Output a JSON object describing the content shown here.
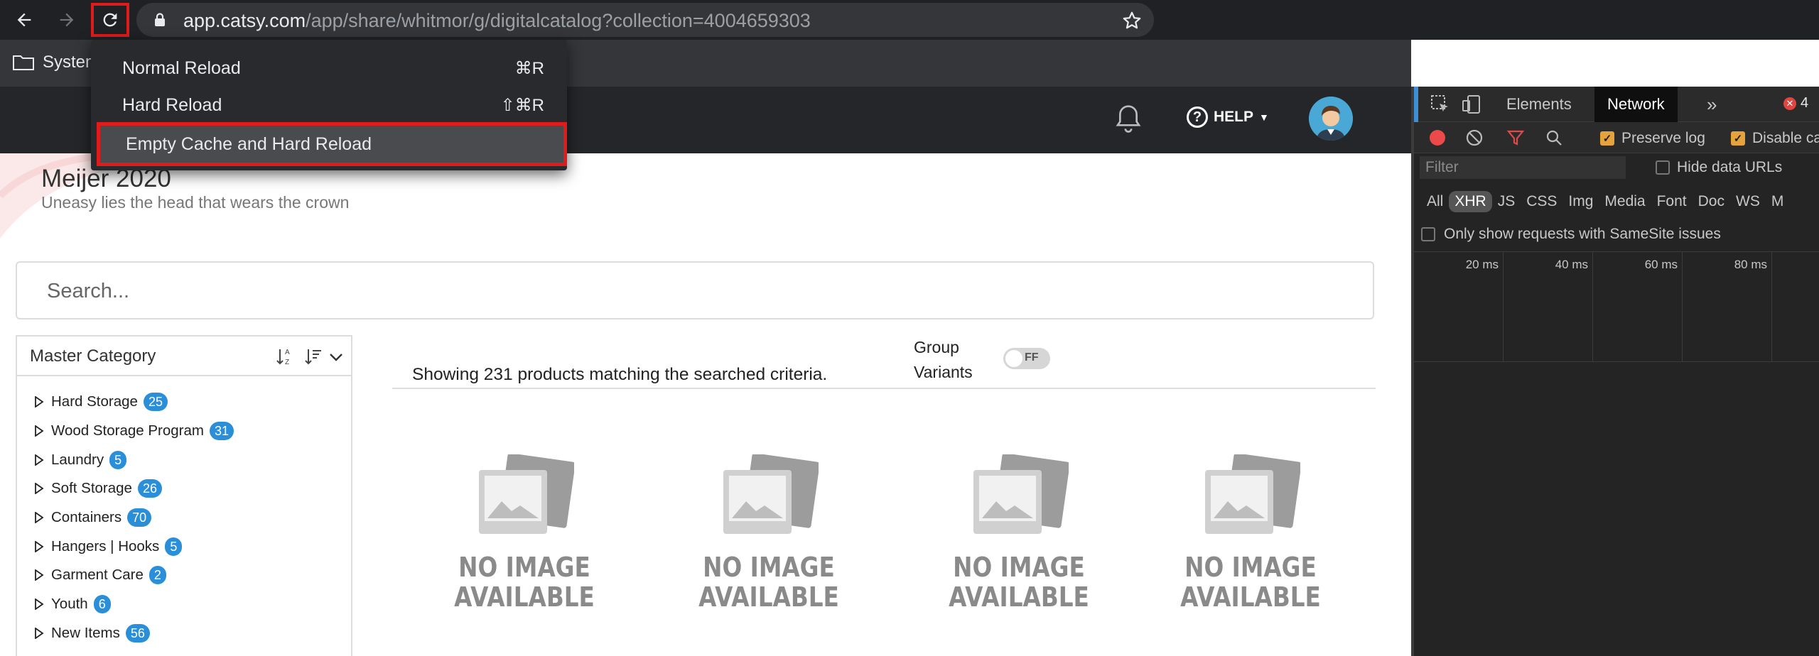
{
  "browser": {
    "url_host": "app.catsy.com",
    "url_path": "/app/share/whitmor/g/digitalcatalog?collection=4004659303",
    "bookmark_folder": "System"
  },
  "reload_menu": {
    "items": [
      {
        "label": "Normal Reload",
        "shortcut": "⌘R"
      },
      {
        "label": "Hard Reload",
        "shortcut": "⇧⌘R"
      },
      {
        "label": "Empty Cache and Hard Reload",
        "shortcut": ""
      }
    ]
  },
  "header": {
    "help_label": "HELP"
  },
  "catalog": {
    "title": "Meijer 2020",
    "subtitle": "Uneasy lies the head that wears the crown"
  },
  "search": {
    "placeholder": "Search..."
  },
  "category_panel": {
    "title": "Master Category",
    "items": [
      {
        "label": "Hard Storage",
        "count": "25"
      },
      {
        "label": "Wood Storage Program",
        "count": "31"
      },
      {
        "label": "Laundry",
        "count": "5"
      },
      {
        "label": "Soft Storage",
        "count": "26"
      },
      {
        "label": "Containers",
        "count": "70"
      },
      {
        "label": "Hangers | Hooks",
        "count": "5"
      },
      {
        "label": "Garment Care",
        "count": "2"
      },
      {
        "label": "Youth",
        "count": "6"
      },
      {
        "label": "New Items",
        "count": "56"
      }
    ]
  },
  "results": {
    "text": "Showing 231 products matching the searched criteria.",
    "group_label_1": "Group",
    "group_label_2": "Variants",
    "toggle_text": "FF"
  },
  "products": {
    "no_image_line1": "NO IMAGE",
    "no_image_line2": "AVAILABLE"
  },
  "devtools": {
    "tabs": [
      "Elements",
      "Network"
    ],
    "active_tab": "Network",
    "error_count": "4",
    "preserve_log": "Preserve log",
    "disable_cache": "Disable ca",
    "filter_placeholder": "Filter",
    "hide_data_urls": "Hide data URLs",
    "types": [
      "All",
      "XHR",
      "JS",
      "CSS",
      "Img",
      "Media",
      "Font",
      "Doc",
      "WS",
      "M"
    ],
    "active_type": "XHR",
    "samesite_label": "Only show requests with SameSite issues",
    "timeline_ticks": [
      "20 ms",
      "40 ms",
      "60 ms",
      "80 ms"
    ]
  },
  "colors": {
    "highlight_red": "#e01b1b",
    "badge_blue": "#2a8fd8",
    "devtools_accent": "#3d8fd8"
  }
}
